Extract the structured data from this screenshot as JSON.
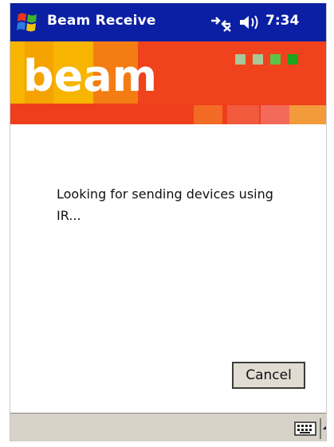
{
  "titlebar": {
    "app_title": "Beam Receive",
    "clock": "7:34",
    "background": "#0a1fa3"
  },
  "banner": {
    "logo_text": "beam",
    "background": "#f0421c",
    "status_dot_colors": [
      "#a8c89a",
      "#a8c89a",
      "#5ec24a",
      "#1fa21f"
    ]
  },
  "main": {
    "message": "Looking for sending devices using IR..."
  },
  "actions": {
    "cancel_label": "Cancel"
  },
  "bottombar": {
    "input_method_icon": "keyboard-icon",
    "sip_menu_icon": "up-arrow-icon"
  }
}
